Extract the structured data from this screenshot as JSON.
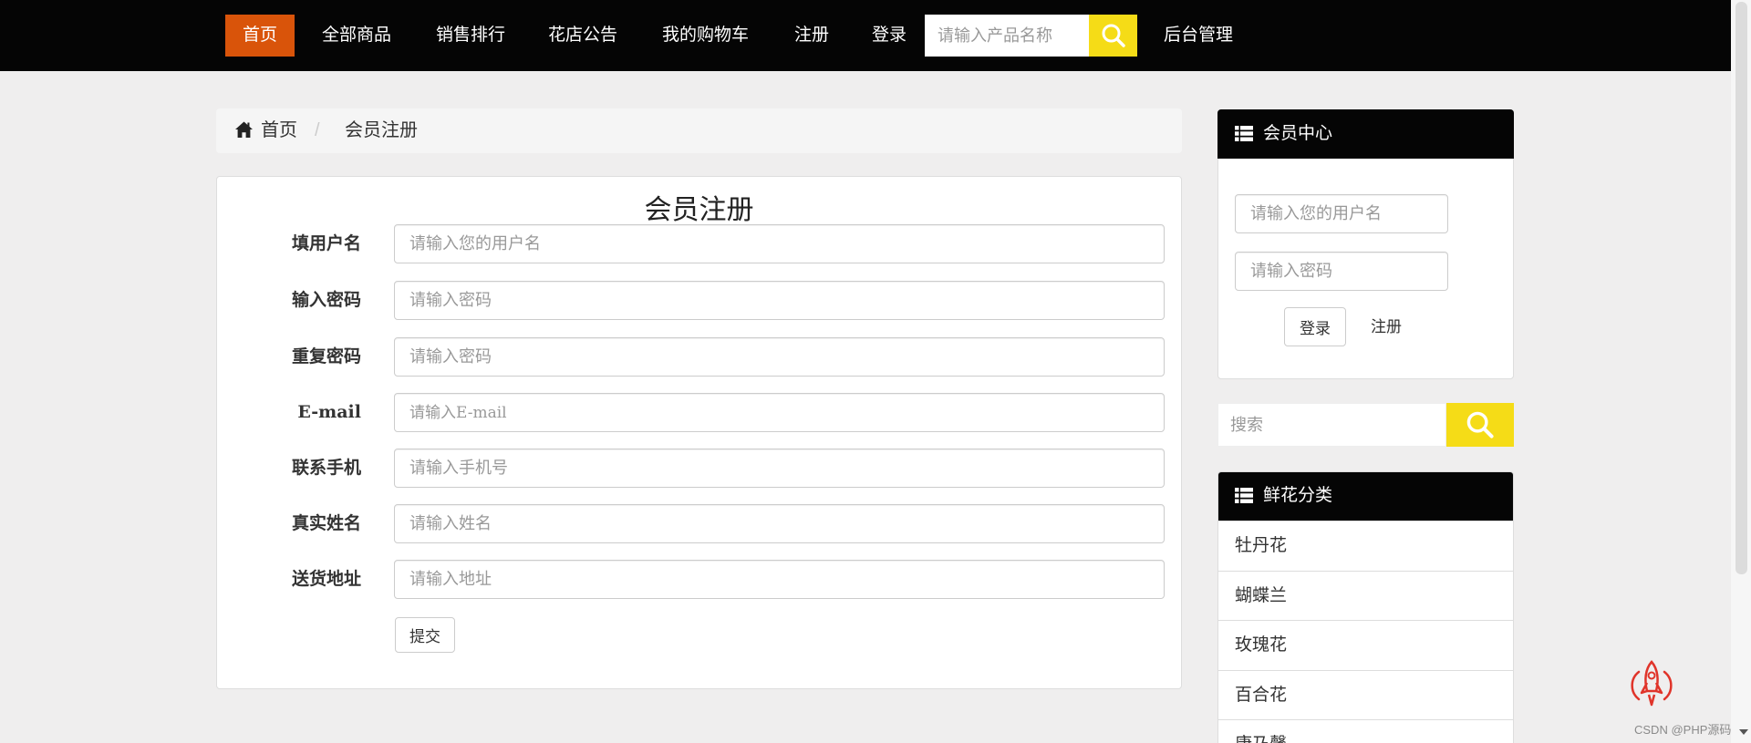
{
  "colors": {
    "nav_bg": "#050505",
    "nav_active_bg": "#d9540a",
    "accent_yellow": "#f5dc17",
    "page_bg": "#efeeee",
    "panel_header_bg": "#050505",
    "rocket": "#e0342a"
  },
  "nav": {
    "items": [
      {
        "label": "首页",
        "active": true
      },
      {
        "label": "全部商品"
      },
      {
        "label": "销售排行"
      },
      {
        "label": "花店公告"
      },
      {
        "label": "我的购物车"
      },
      {
        "label": "注册"
      },
      {
        "label": "登录"
      }
    ],
    "search_placeholder": "请输入产品名称",
    "search_icon": "search-icon",
    "admin_label": "后台管理"
  },
  "breadcrumb": {
    "home_icon": "home-icon",
    "home": "首页",
    "separator": "/",
    "current": "会员注册"
  },
  "register": {
    "title": "会员注册",
    "fields": [
      {
        "label": "填用户名",
        "placeholder": "请输入您的用户名"
      },
      {
        "label": "输入密码",
        "placeholder": "请输入密码"
      },
      {
        "label": "重复密码",
        "placeholder": "请输入密码"
      },
      {
        "label": "E-mail",
        "placeholder": "请输入E-mail"
      },
      {
        "label": "联系手机",
        "placeholder": "请输入手机号"
      },
      {
        "label": "真实姓名",
        "placeholder": "请输入姓名"
      },
      {
        "label": "送货地址",
        "placeholder": "请输入地址"
      }
    ],
    "submit": "提交"
  },
  "member_center": {
    "icon": "list-icon",
    "title": "会员中心",
    "username_placeholder": "请输入您的用户名",
    "password_placeholder": "请输入密码",
    "login": "登录",
    "register": "注册"
  },
  "sidebar_search": {
    "placeholder": "搜索",
    "icon": "search-icon"
  },
  "categories": {
    "icon": "list-icon",
    "title": "鲜花分类",
    "items": [
      "牡丹花",
      "蝴蝶兰",
      "玫瑰花",
      "百合花",
      "康乃馨"
    ]
  },
  "watermark": {
    "icon": "rocket-icon",
    "text": "CSDN @PHP源码"
  }
}
